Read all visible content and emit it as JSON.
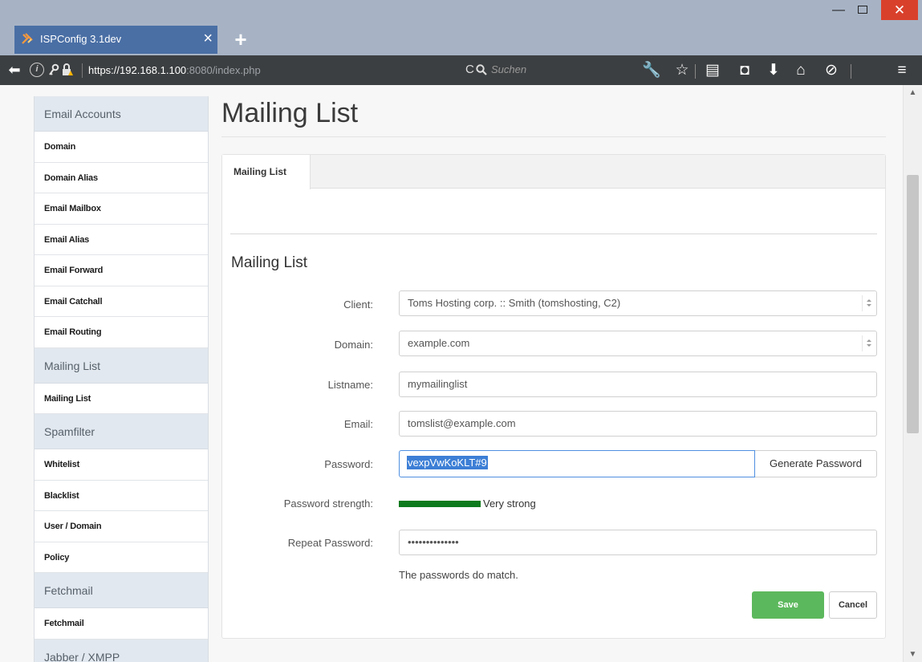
{
  "browser": {
    "tab_title": "ISPConfig 3.1dev",
    "url_host": "https://192.168.1.100",
    "url_rest": ":8080/index.php",
    "search_placeholder": "Suchen"
  },
  "sidebar": {
    "sections": [
      {
        "header": "Email Accounts",
        "items": [
          "Domain",
          "Domain Alias",
          "Email Mailbox",
          "Email Alias",
          "Email Forward",
          "Email Catchall",
          "Email Routing"
        ]
      },
      {
        "header": "Mailing List",
        "items": [
          "Mailing List"
        ]
      },
      {
        "header": "Spamfilter",
        "items": [
          "Whitelist",
          "Blacklist",
          "User / Domain",
          "Policy"
        ]
      },
      {
        "header": "Fetchmail",
        "items": [
          "Fetchmail"
        ]
      },
      {
        "header": "Jabber / XMPP",
        "items": []
      }
    ]
  },
  "page": {
    "title": "Mailing List",
    "tab_label": "Mailing List",
    "section_title": "Mailing List"
  },
  "form": {
    "client_label": "Client:",
    "client_value": "Toms Hosting corp. :: Smith (tomshosting, C2)",
    "domain_label": "Domain:",
    "domain_value": "example.com",
    "listname_label": "Listname:",
    "listname_value": "mymailinglist",
    "email_label": "Email:",
    "email_value": "tomslist@example.com",
    "password_label": "Password:",
    "password_value": "vexpVwKoKLT#9",
    "generate_label": "Generate Password",
    "strength_label": "Password strength:",
    "strength_value": "Very strong",
    "repeat_label": "Repeat Password:",
    "repeat_value": "••••••••••••••",
    "match_text": "The passwords do match.",
    "save_label": "Save",
    "cancel_label": "Cancel"
  }
}
